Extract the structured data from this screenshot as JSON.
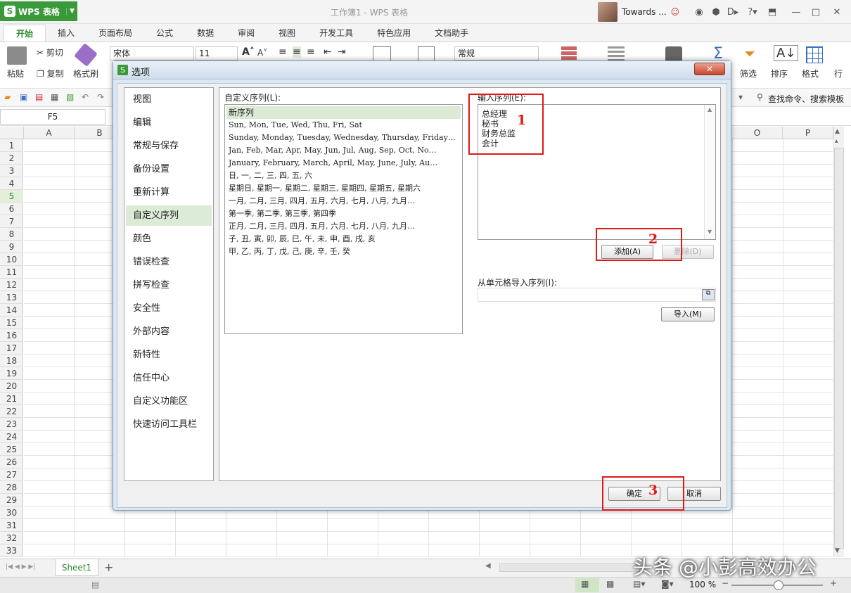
{
  "app": {
    "name": "WPS 表格",
    "doc_title": "工作簿1 - WPS 表格",
    "user": "Towards ..."
  },
  "ribbon_tabs": [
    "开始",
    "插入",
    "页面布局",
    "公式",
    "数据",
    "审阅",
    "视图",
    "开发工具",
    "特色应用",
    "文档助手"
  ],
  "ribbon": {
    "paste": "粘贴",
    "cut": "剪切",
    "copy": "复制",
    "format_painter": "格式刷",
    "font_name": "宋体",
    "font_size": "11",
    "number_format": "常规",
    "filter": "筛选",
    "sort": "排序",
    "format": "格式",
    "row": "行",
    "search_label": "查找命令、搜索模板"
  },
  "formula_bar": {
    "cell_ref": "F5"
  },
  "columns": [
    "A",
    "B",
    "O",
    "P"
  ],
  "rows": [
    "1",
    "2",
    "3",
    "4",
    "5",
    "6",
    "7",
    "8",
    "9",
    "10",
    "11",
    "12",
    "13",
    "14",
    "15",
    "16",
    "17",
    "18",
    "19",
    "20",
    "21",
    "22",
    "23",
    "24",
    "25",
    "26",
    "27",
    "28",
    "29",
    "30",
    "31",
    "32",
    "33"
  ],
  "sheet": {
    "tab": "Sheet1",
    "add": "+"
  },
  "status": {
    "zoom": "100 %"
  },
  "dialog": {
    "title": "选项",
    "nav": [
      "视图",
      "编辑",
      "常规与保存",
      "备份设置",
      "重新计算",
      "自定义序列",
      "颜色",
      "错误检查",
      "拼写检查",
      "安全性",
      "外部内容",
      "新特性",
      "信任中心",
      "自定义功能区",
      "快速访问工具栏"
    ],
    "nav_selected_index": 5,
    "custom_lists_label": "自定义序列(L):",
    "custom_lists": [
      "新序列",
      "Sun, Mon, Tue, Wed, Thu, Fri, Sat",
      "Sunday, Monday, Tuesday, Wednesday, Thursday, Friday…",
      "Jan, Feb, Mar, Apr, May, Jun, Jul, Aug, Sep, Oct, No…",
      "January, February, March, April, May, June, July, Au…",
      "日, 一, 二, 三, 四, 五, 六",
      "星期日, 星期一, 星期二, 星期三, 星期四, 星期五, 星期六",
      "一月, 二月, 三月, 四月, 五月, 六月, 七月, 八月, 九月…",
      "第一季, 第二季, 第三季, 第四季",
      "正月, 二月, 三月, 四月, 五月, 六月, 七月, 八月, 九月…",
      "子, 丑, 寅, 卯, 辰, 巳, 午, 未, 申, 酉, 戌, 亥",
      "甲, 乙, 丙, 丁, 戊, 己, 庚, 辛, 壬, 癸"
    ],
    "entries_label": "输入序列(E):",
    "entries": [
      "总经理",
      "秘书",
      "财务总监",
      "会计"
    ],
    "add_button": "添加(A)",
    "delete_button": "删除(D)",
    "import_label": "从单元格导入序列(I):",
    "import_button": "导入(M)",
    "ok_button": "确定",
    "cancel_button": "取消",
    "annotations": [
      "1",
      "2",
      "3"
    ]
  },
  "watermark": "头条 @小彭高效办公",
  "colors": {
    "accent": "#3a9a3a",
    "annotation": "#e01818",
    "selection": "#dcebd6"
  }
}
